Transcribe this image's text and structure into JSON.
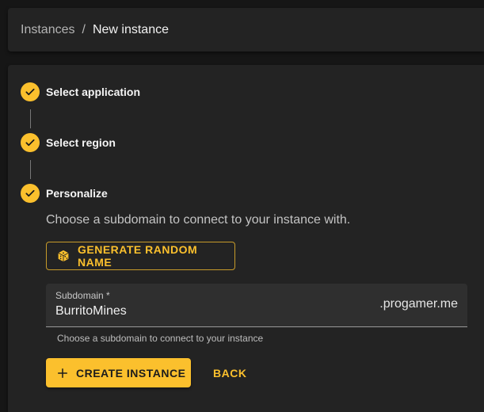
{
  "breadcrumb": {
    "parent": "Instances",
    "separator": "/",
    "current": "New instance"
  },
  "stepper": {
    "steps": [
      {
        "label": "Select application",
        "status": "completed"
      },
      {
        "label": "Select region",
        "status": "completed"
      },
      {
        "label": "Personalize",
        "status": "completed"
      }
    ],
    "description": "Choose a subdomain to connect to your instance with."
  },
  "generate_button": {
    "label": "GENERATE RANDOM NAME",
    "icon": "dice-icon"
  },
  "subdomain_field": {
    "label": "Subdomain *",
    "value": "BurritoMines",
    "suffix": ".progamer.me",
    "helper": "Choose a subdomain to connect to your instance"
  },
  "actions": {
    "create_label": "CREATE INSTANCE",
    "create_icon": "plus-icon",
    "back_label": "BACK"
  },
  "colors": {
    "accent": "#fbc02d",
    "background": "#161616",
    "surface": "#232323"
  }
}
